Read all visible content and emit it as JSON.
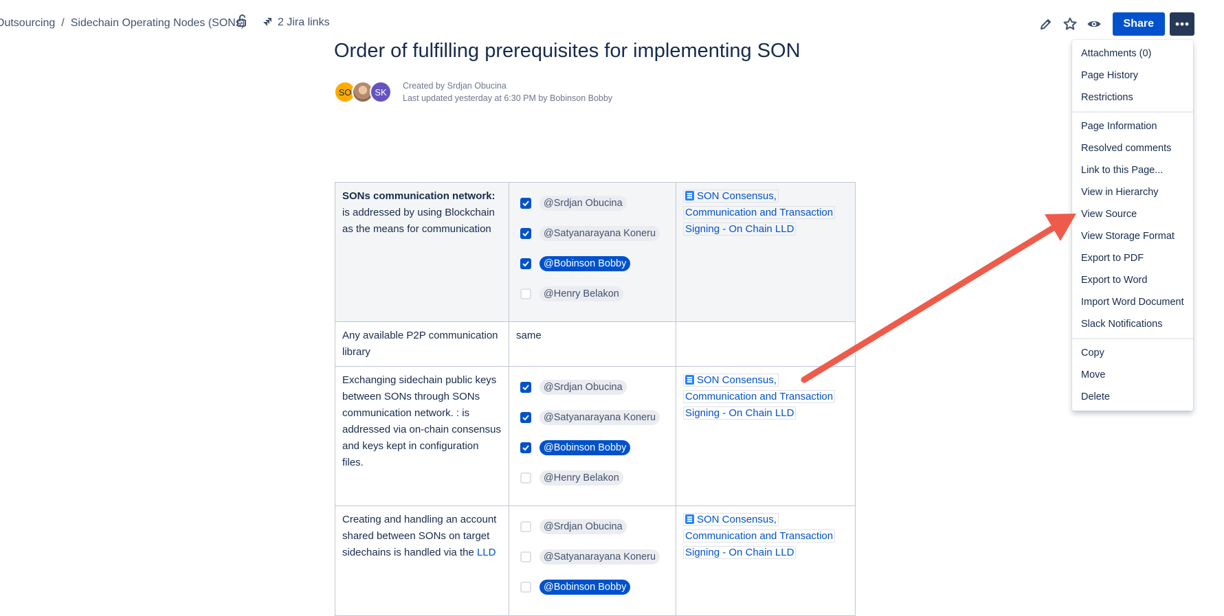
{
  "header": {
    "breadcrumbs": [
      "Outsourcing",
      "Sidechain Operating Nodes (SONs)"
    ],
    "jira_links": "2 Jira links",
    "share_label": "Share",
    "icons": [
      "lock-icon",
      "jira-icon",
      "edit-icon",
      "star-icon",
      "watch-icon",
      "more-icon"
    ]
  },
  "page": {
    "title": "Order of fulfilling prerequisites for implementing SON",
    "created_by": "Created by Srdjan Obucina",
    "last_updated": "Last updated yesterday at 6:30 PM by Bobinson Bobby",
    "avatars": [
      "SO",
      "",
      "SK"
    ]
  },
  "table": {
    "rows": [
      {
        "text_bold": "SONs communication network:",
        "text": " is addressed by using Blockchain as the means for communication",
        "tasks": [
          {
            "name": "@Srdjan Obucina",
            "checked": true
          },
          {
            "name": "@Satyanarayana Koneru",
            "checked": true
          },
          {
            "name": "@Bobinson Bobby",
            "checked": true
          },
          {
            "name": "@Henry Belakon",
            "checked": false
          }
        ],
        "link": "SON  Consensus, Communication and Transaction Signing - On Chain LLD"
      },
      {
        "text": "Any available P2P communication library",
        "plain": "same"
      },
      {
        "text": "Exchanging sidechain public keys between SONs through SONs communication network. : is addressed via on-chain consensus and keys kept in configuration files.",
        "tasks": [
          {
            "name": "@Srdjan Obucina",
            "checked": true
          },
          {
            "name": "@Satyanarayana Koneru",
            "checked": true
          },
          {
            "name": "@Bobinson Bobby",
            "checked": true
          },
          {
            "name": "@Henry Belakon",
            "checked": false
          }
        ],
        "link": "SON  Consensus, Communication and Transaction Signing - On Chain LLD"
      },
      {
        "text": "Creating and handling an account shared between SONs on target sidechains is handled via the ",
        "inline_link": "LLD",
        "tasks": [
          {
            "name": "@Srdjan Obucina",
            "checked": false
          },
          {
            "name": "@Satyanarayana Koneru",
            "checked": false
          },
          {
            "name": "@Bobinson Bobby",
            "checked": false
          }
        ],
        "link": "SON  Consensus, Communication and Transaction Signing - On Chain LLD"
      }
    ]
  },
  "menu": {
    "groups": [
      [
        "Attachments (0)",
        "Page History",
        "Restrictions"
      ],
      [
        "Page Information",
        "Resolved comments",
        "Link to this Page...",
        "View in Hierarchy",
        "View Source",
        "View Storage Format",
        "Export to PDF",
        "Export to Word",
        "Import Word Document",
        "Slack Notifications"
      ],
      [
        "Copy",
        "Move",
        "Delete"
      ]
    ]
  },
  "annotation": {
    "color": "#ef5b4a"
  }
}
